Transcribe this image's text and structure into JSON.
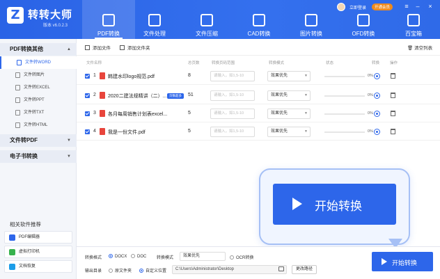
{
  "app": {
    "name": "转转大师",
    "version": "版本 v6.0.2.3",
    "logo": "Z"
  },
  "user": {
    "name": "立即登录",
    "vip": "开通会员"
  },
  "tabs": [
    {
      "label": "PDF转换",
      "active": true
    },
    {
      "label": "文件处理"
    },
    {
      "label": "文件压缩"
    },
    {
      "label": "CAD转换"
    },
    {
      "label": "图片转换"
    },
    {
      "label": "OFD转换"
    },
    {
      "label": "百宝箱"
    }
  ],
  "sidebar": {
    "group1": "PDF转换其他",
    "items": [
      "文件转WORD",
      "文件转图片",
      "文件转EXCEL",
      "文件转PPT",
      "文件转TXT",
      "文件转HTML"
    ],
    "group2": "文件转PDF",
    "group3": "电子书转换",
    "rec_title": "相关软件推荐",
    "recs": [
      "PDF编辑器",
      "虚拟打印机",
      "文档恢复"
    ]
  },
  "toolbar": {
    "add_file": "添加文件",
    "add_folder": "添加文件夹",
    "clear": "清空列表"
  },
  "table": {
    "headers": [
      "文件名称",
      "总页数",
      "转换页码范围",
      "转换模式",
      "状态",
      "转换",
      "操作"
    ],
    "range_placeholder": "请输入，如1,5-10",
    "rows": [
      {
        "num": "1",
        "name": "韩建水印logo规范.pdf",
        "pages": "8",
        "mode": "效果优先",
        "pct": "0%"
      },
      {
        "num": "2",
        "name": "2020二建法规精讲（二）...",
        "badge": "页数超多",
        "pages": "51",
        "mode": "效果优先",
        "pct": "0%"
      },
      {
        "num": "3",
        "name": "各月每周销售计划表excel...",
        "pages": "5",
        "mode": "效果优先",
        "pct": "0%"
      },
      {
        "num": "4",
        "name": "我是一份文件.pdf",
        "pages": "5",
        "mode": "效果优先",
        "pct": "0%"
      }
    ]
  },
  "callout": {
    "label": "开始转换"
  },
  "bottom": {
    "format_label": "转换格式",
    "docx": "DOCX",
    "doc": "DOC",
    "mode_label": "转换模式",
    "mode_value": "效果优先",
    "ocr": "OCR转换",
    "out_label": "输出目录",
    "orig": "原文件夹",
    "custom": "自定义位置",
    "path": "C:\\Users\\Administrator\\Desktop",
    "change": "更改路径",
    "start": "开始转换"
  }
}
